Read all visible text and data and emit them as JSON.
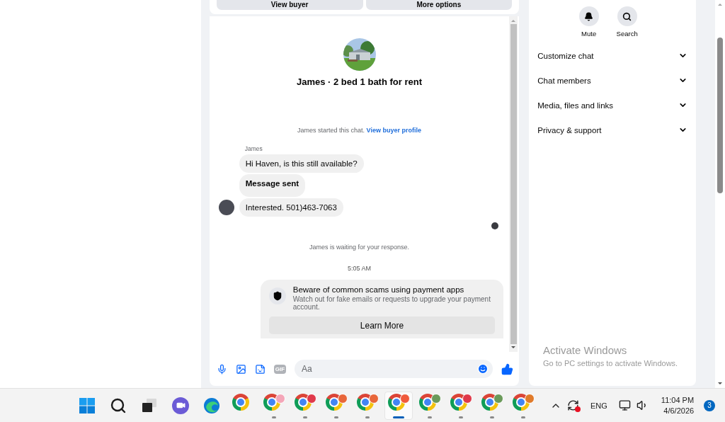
{
  "top_buttons": [
    "View buyer",
    "More options"
  ],
  "chat": {
    "title": "James · 2 bed 1 bath for rent",
    "started": "James started this chat.",
    "started_link": "View buyer profile",
    "sender": "James",
    "messages": [
      {
        "text": "Hi Haven, is this still available?",
        "bold": false,
        "avatar": false
      },
      {
        "text": "Message sent",
        "bold": true,
        "avatar": false
      },
      {
        "text": "Interested. 501)463-7063",
        "bold": false,
        "avatar": true
      }
    ],
    "waiting": "James is waiting for your response.",
    "time": "5:05 AM",
    "notice": {
      "title": "Beware of common scams using payment apps",
      "body": "Watch out for fake emails or requests to upgrade your payment account.",
      "button": "Learn More"
    },
    "composer": {
      "gif_label": "GIF",
      "placeholder": "Aa"
    }
  },
  "sidebar": {
    "actions": [
      {
        "label": "Mute",
        "kind": "bell"
      },
      {
        "label": "Search",
        "kind": "search"
      }
    ],
    "sections": [
      {
        "label": "Customize chat",
        "expanded": false
      },
      {
        "label": "Chat members",
        "expanded": false
      },
      {
        "label": "Media, files and links",
        "expanded": false
      },
      {
        "label": "Privacy & support",
        "expanded": false
      }
    ]
  },
  "activation_notice": {
    "title": "Activate Windows",
    "subtitle": "Go to PC settings to activate Windows."
  },
  "taskbar": {
    "apps": [
      {
        "kind": "start",
        "running": false,
        "selected": false
      },
      {
        "kind": "search",
        "running": false,
        "selected": false
      },
      {
        "kind": "taskview",
        "running": false,
        "selected": false
      },
      {
        "kind": "meet",
        "running": false,
        "selected": false
      },
      {
        "kind": "edge",
        "running": false,
        "selected": false
      },
      {
        "kind": "chrome",
        "running": false,
        "selected": false
      },
      {
        "kind": "chrome",
        "color": "#f4a6b8",
        "running": true,
        "selected": false
      },
      {
        "kind": "chrome",
        "color": "#e0394a",
        "running": true,
        "selected": false
      },
      {
        "kind": "chrome",
        "color": "#e8663a",
        "running": true,
        "selected": false
      },
      {
        "kind": "chrome",
        "color": "#e8663a",
        "running": true,
        "selected": false
      },
      {
        "kind": "chrome",
        "color": "#f05a3c",
        "running": true,
        "selected": true
      },
      {
        "kind": "chrome",
        "color": "#6a9a5a",
        "running": true,
        "selected": false
      },
      {
        "kind": "chrome",
        "color": "#e0394a",
        "running": true,
        "selected": false
      },
      {
        "kind": "chrome",
        "color": "#6a9a5a",
        "running": true,
        "selected": false
      },
      {
        "kind": "chrome",
        "color": "#e07a2a",
        "running": true,
        "selected": false
      }
    ],
    "language": "ENG",
    "time": "11:04 PM",
    "date": "4/6/2026",
    "notifications": "3"
  }
}
